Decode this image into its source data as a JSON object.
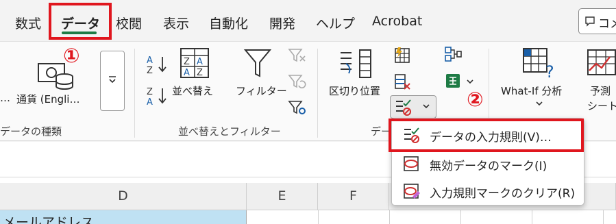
{
  "tabs": [
    "数式",
    "データ",
    "校閲",
    "表示",
    "自動化",
    "開発",
    "ヘルプ",
    "Acrobat"
  ],
  "comment_label": "コメ",
  "ribbon": {
    "currency_label": "通貨 (Engli…",
    "currency_prefix": "…",
    "datatype_group": "データの種類",
    "sort_label": "並べ替え",
    "filter_label": "フィルター",
    "sort_filter_group": "並べ替えとフィルター",
    "text_to_columns_label": "区切り位置",
    "datatools_group": "デー",
    "whatif_label": "What-If 分析",
    "forecast_label_1": "予測",
    "forecast_label_2": "シート"
  },
  "badges": [
    "①",
    "②"
  ],
  "menu": {
    "items": [
      "データの入力規則(V)…",
      "無効データのマーク(I)",
      "入力規則マークのクリア(R)"
    ]
  },
  "sheet": {
    "columns": [
      "D",
      "E",
      "F"
    ],
    "cell_d": "メールアドレス"
  },
  "colors": {
    "accent_green": "#1e7b45",
    "highlight_red": "#e0161e",
    "cell_blue": "#bfe1f3"
  }
}
